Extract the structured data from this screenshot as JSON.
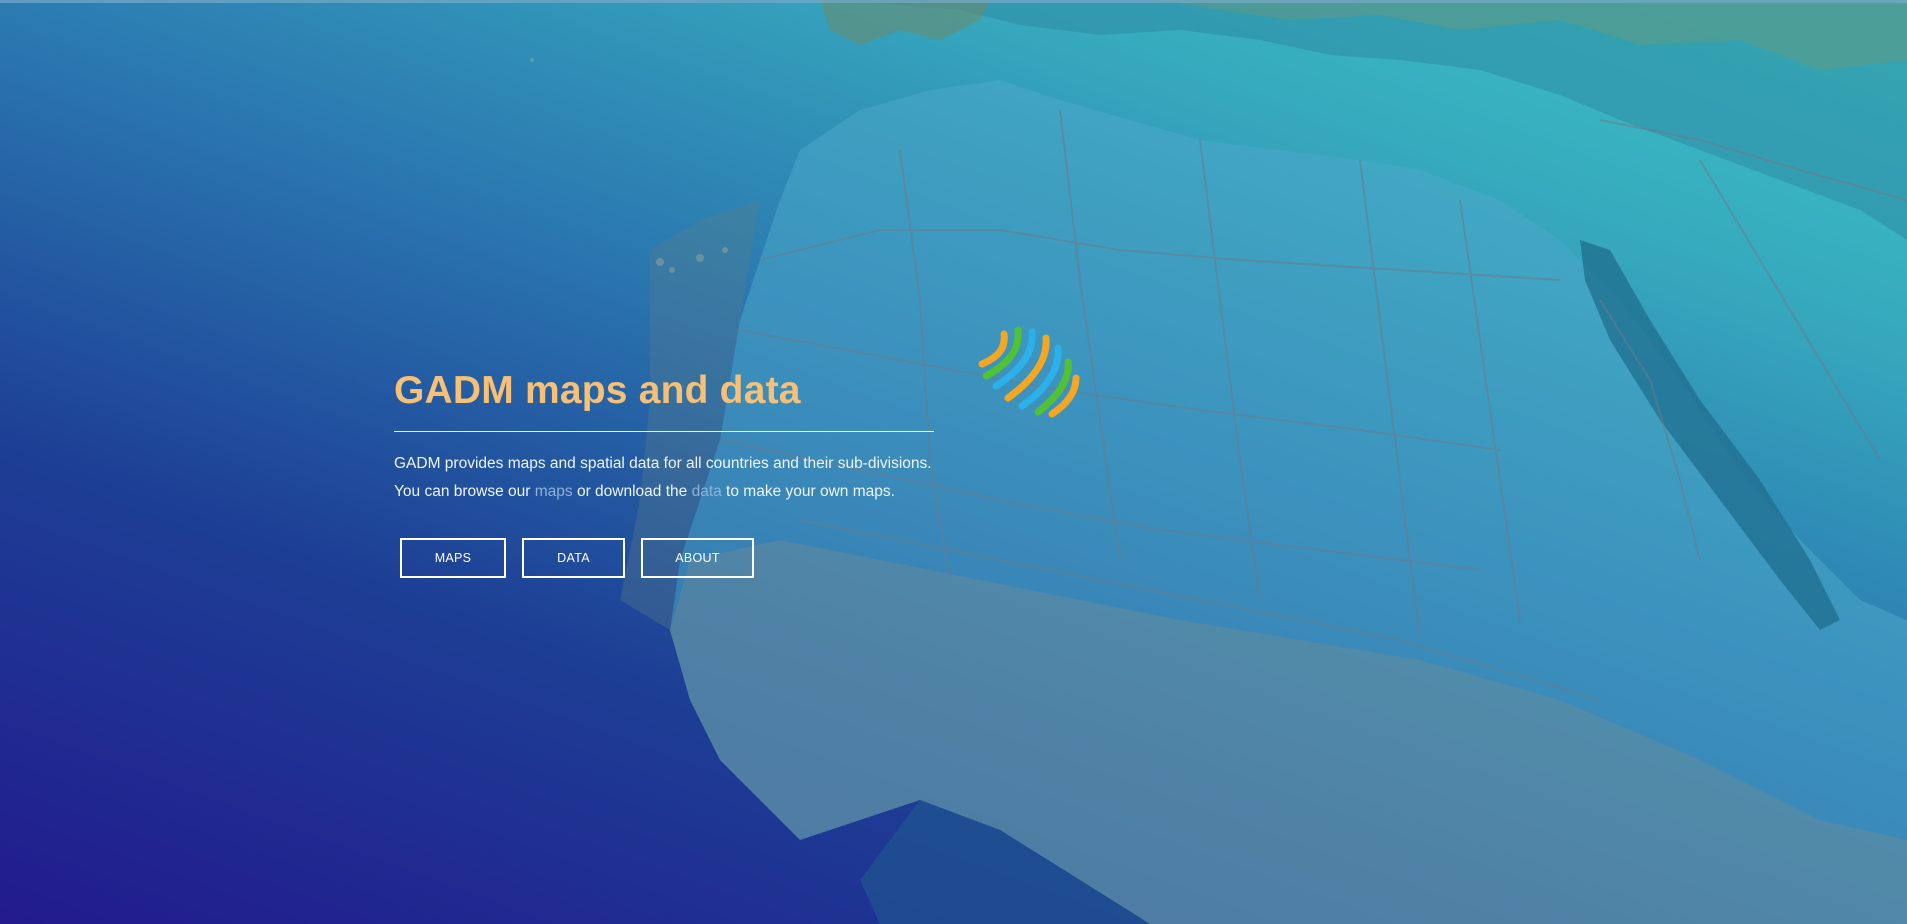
{
  "hero": {
    "title": "GADM maps and data",
    "description_parts": {
      "part1": "GADM provides maps and spatial data for all countries and their sub-divisions. You can browse our ",
      "link_maps": "maps",
      "part2": " or download the ",
      "link_data": "data",
      "part3": " to make your own maps."
    },
    "buttons": {
      "maps": "MAPS",
      "data": "DATA",
      "about": "ABOUT"
    }
  },
  "logo": {
    "icon": "gadm-logo-icon",
    "colors": [
      "#f5a623",
      "#2bb0e8",
      "#52c234"
    ]
  },
  "colors": {
    "title": "#f6c077",
    "link": "#8fb2d6",
    "background_dark": "#221a8e",
    "background_light": "#3bc7c4"
  }
}
